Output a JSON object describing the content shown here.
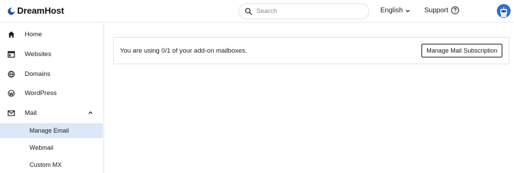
{
  "header": {
    "brand": "DreamHost",
    "search_placeholder": "Search",
    "language": "English",
    "support": "Support"
  },
  "sidebar": {
    "items": [
      {
        "label": "Home",
        "icon": "home-icon"
      },
      {
        "label": "Websites",
        "icon": "browser-window-icon"
      },
      {
        "label": "Domains",
        "icon": "globe-icon"
      },
      {
        "label": "WordPress",
        "icon": "wordpress-icon"
      },
      {
        "label": "Mail",
        "icon": "envelope-icon",
        "expanded": true
      }
    ],
    "mail_sub_items": [
      {
        "label": "Manage Email",
        "active": true
      },
      {
        "label": "Webmail",
        "active": false
      },
      {
        "label": "Custom MX",
        "active": false
      }
    ]
  },
  "main": {
    "banner_text": "You are using 0/1 of your add-on mailboxes.",
    "banner_button": "Manage Mail Subscription"
  },
  "colors": {
    "active_sub_item_bg": "#dce8f7",
    "avatar_bg": "#2f6fc4",
    "brand_mark": "#1e4fa0"
  }
}
